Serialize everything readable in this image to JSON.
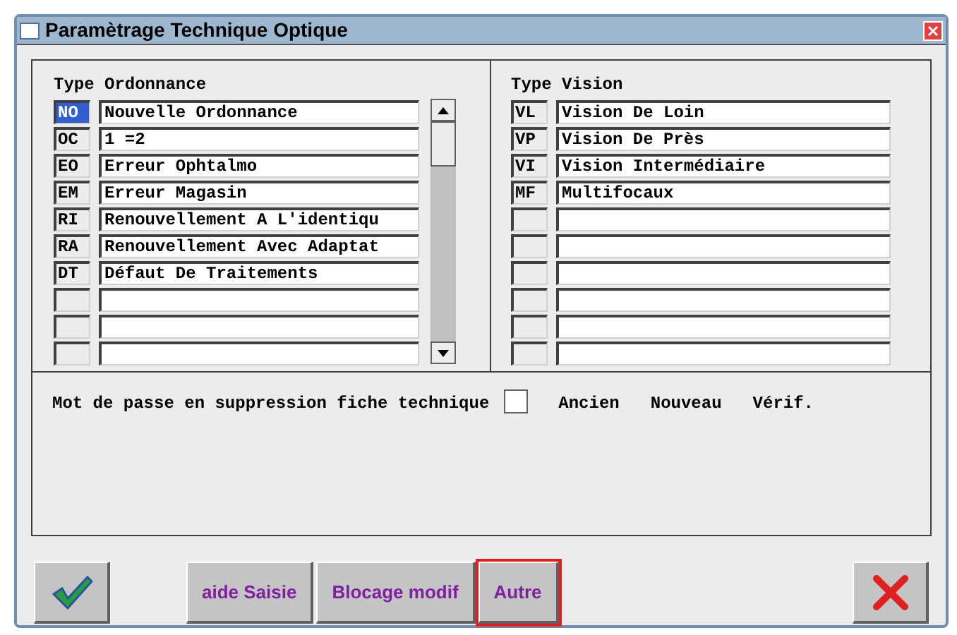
{
  "window": {
    "title": "Paramètrage Technique Optique"
  },
  "ordonnance": {
    "title": "Type Ordonnance",
    "rows": [
      {
        "kind": "filled",
        "code": "NO",
        "text": "Nouvelle Ordonnance",
        "selected": true
      },
      {
        "kind": "filled",
        "code": "OC",
        "text": "1 =2",
        "selected": false
      },
      {
        "kind": "filled",
        "code": "EO",
        "text": "Erreur Ophtalmo",
        "selected": false
      },
      {
        "kind": "filled",
        "code": "EM",
        "text": "Erreur Magasin",
        "selected": false
      },
      {
        "kind": "filled",
        "code": "RI",
        "text": "Renouvellement A L'identiqu",
        "selected": false
      },
      {
        "kind": "filled",
        "code": "RA",
        "text": "Renouvellement Avec Adaptat",
        "selected": false
      },
      {
        "kind": "filled",
        "code": "DT",
        "text": "Défaut De Traitements",
        "selected": false
      },
      {
        "kind": "empty",
        "selected": false
      },
      {
        "kind": "empty",
        "selected": false
      },
      {
        "kind": "empty",
        "selected": false
      }
    ]
  },
  "vision": {
    "title": "Type Vision",
    "rows": [
      {
        "kind": "filled",
        "code": "VL",
        "text": "Vision De Loin"
      },
      {
        "kind": "filled",
        "code": "VP",
        "text": "Vision De Près"
      },
      {
        "kind": "filled",
        "code": "VI",
        "text": "Vision Intermédiaire"
      },
      {
        "kind": "filled",
        "code": "MF",
        "text": "Multifocaux"
      },
      {
        "kind": "empty"
      },
      {
        "kind": "empty"
      },
      {
        "kind": "empty"
      },
      {
        "kind": "empty"
      },
      {
        "kind": "empty"
      },
      {
        "kind": "empty"
      }
    ]
  },
  "password": {
    "label": "Mot de passe en suppression fiche technique",
    "checked": false,
    "fields": [
      "Ancien",
      "Nouveau",
      "Vérif."
    ]
  },
  "buttons": [
    {
      "kind": "ok",
      "focused": false
    },
    {
      "kind": "text",
      "label": "aide Saisie",
      "focused": false
    },
    {
      "kind": "text",
      "label": "Blocage modif",
      "focused": false
    },
    {
      "kind": "text",
      "label": "Autre",
      "focused": true
    },
    {
      "kind": "cancel",
      "focused": false
    }
  ]
}
